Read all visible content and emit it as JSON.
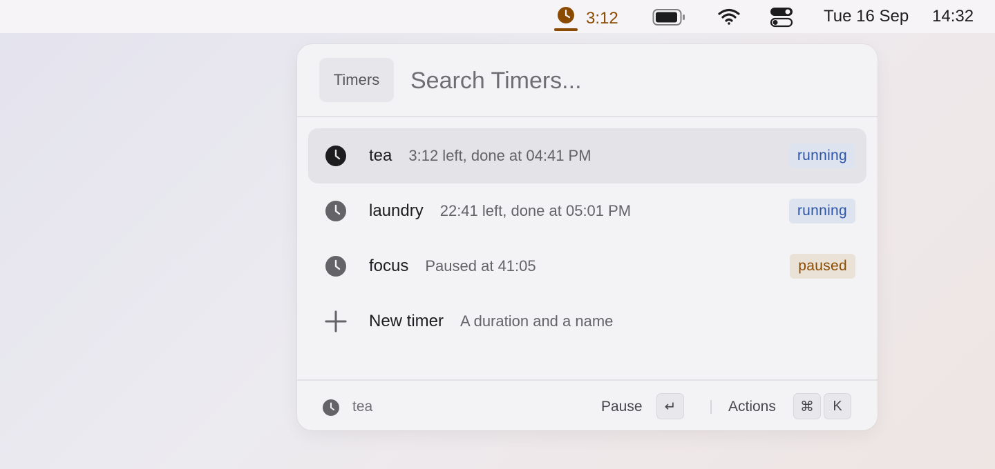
{
  "menubar": {
    "timer_display": "3:12",
    "date": "Tue 16 Sep",
    "time": "14:32",
    "timer_icon": "clock-icon",
    "accent_color": "#8a4a00"
  },
  "search": {
    "scope_label": "Timers",
    "placeholder": "Search Timers..."
  },
  "timers": [
    {
      "name": "tea",
      "subtitle": "3:12 left, done at 04:41 PM",
      "status": "running",
      "selected": true
    },
    {
      "name": "laundry",
      "subtitle": "22:41 left, done at 05:01 PM",
      "status": "running",
      "selected": false
    },
    {
      "name": "focus",
      "subtitle": "Paused at 41:05",
      "status": "paused",
      "selected": false
    }
  ],
  "new_timer": {
    "label": "New timer",
    "subtitle": "A duration and a name",
    "icon": "plus-icon"
  },
  "footer": {
    "selected_name": "tea",
    "primary_action": "Pause",
    "primary_key": "↵",
    "actions_label": "Actions",
    "actions_key_1": "⌘",
    "actions_key_2": "K"
  },
  "colors": {
    "running_badge_text": "#2d56a8",
    "running_badge_bg": "#dde3ef",
    "paused_badge_text": "#8a4a00",
    "paused_badge_bg": "#ebe2d7"
  }
}
